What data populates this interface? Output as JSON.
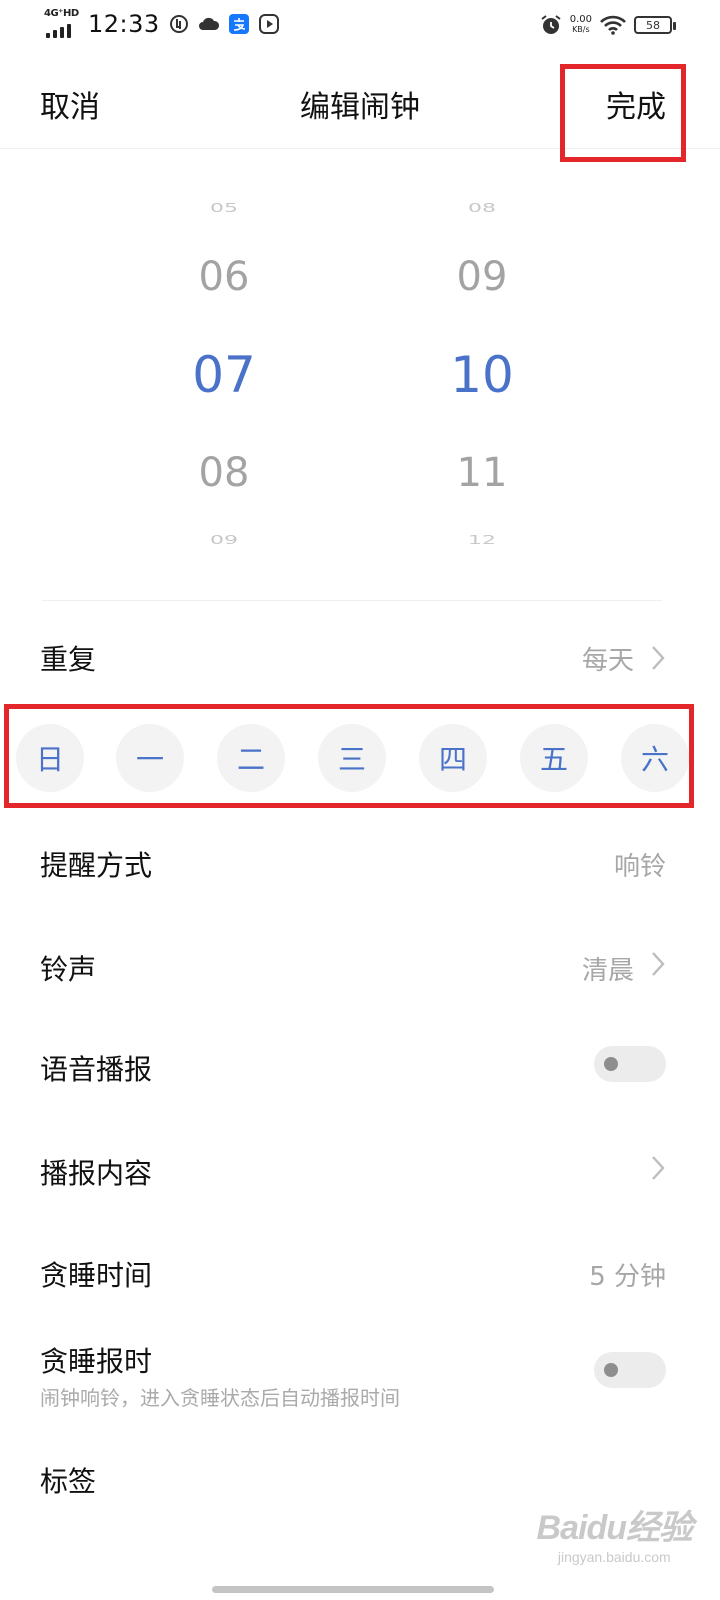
{
  "status_bar": {
    "network": "4G⁺HD",
    "time": "12:33",
    "net_speed_value": "0.00",
    "net_speed_unit": "KB/s",
    "battery": "58",
    "icons": [
      "data-saver-icon",
      "cloud-icon",
      "alipay-icon",
      "media-play-icon",
      "alarm-icon",
      "wifi-icon",
      "battery-icon"
    ]
  },
  "header": {
    "cancel": "取消",
    "title": "编辑闹钟",
    "done": "完成"
  },
  "picker": {
    "hours": [
      "05",
      "06",
      "07",
      "08",
      "09"
    ],
    "minutes": [
      "08",
      "09",
      "10",
      "11",
      "12"
    ],
    "selected_hour": "07",
    "selected_minute": "10",
    "accent_color": "#4a72c9"
  },
  "repeat": {
    "label": "重复",
    "value": "每天",
    "days": [
      "日",
      "一",
      "二",
      "三",
      "四",
      "五",
      "六"
    ]
  },
  "reminder_mode": {
    "label": "提醒方式",
    "value": "响铃"
  },
  "ringtone": {
    "label": "铃声",
    "value": "清晨"
  },
  "voice_broadcast": {
    "label": "语音播报",
    "enabled": false
  },
  "broadcast_content": {
    "label": "播报内容"
  },
  "snooze_time": {
    "label": "贪睡时间",
    "value": "5 分钟"
  },
  "snooze_announce": {
    "label": "贪睡报时",
    "description": "闹钟响铃，进入贪睡状态后自动播报时间",
    "enabled": false
  },
  "tag": {
    "label": "标签"
  },
  "watermark": {
    "logo": "Baidu经验",
    "url": "jingyan.baidu.com"
  },
  "highlight_color": "#e3262a"
}
